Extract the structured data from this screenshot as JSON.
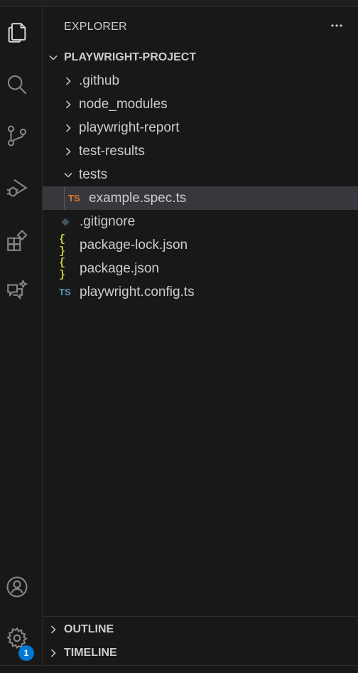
{
  "explorer": {
    "title": "EXPLORER",
    "project": "PLAYWRIGHT-PROJECT",
    "items": [
      {
        "label": ".github",
        "type": "folder"
      },
      {
        "label": "node_modules",
        "type": "folder"
      },
      {
        "label": "playwright-report",
        "type": "folder"
      },
      {
        "label": "test-results",
        "type": "folder"
      },
      {
        "label": "tests",
        "type": "folder-open"
      },
      {
        "label": "example.spec.ts",
        "type": "ts-file",
        "icon_text": "TS",
        "icon_color": "#e37933"
      },
      {
        "label": ".gitignore",
        "type": "git-file"
      },
      {
        "label": "package-lock.json",
        "type": "json-file",
        "icon_text": "{ }"
      },
      {
        "label": "package.json",
        "type": "json-file",
        "icon_text": "{ }"
      },
      {
        "label": "playwright.config.ts",
        "type": "ts-file",
        "icon_text": "TS",
        "icon_color": "#519aba"
      }
    ]
  },
  "panels": {
    "outline": "OUTLINE",
    "timeline": "TIMELINE"
  },
  "activity_bar": {
    "icons": [
      "explorer-icon",
      "search-icon",
      "source-control-icon",
      "run-debug-icon",
      "extensions-icon",
      "chat-icon",
      "account-icon",
      "settings-gear-icon"
    ],
    "settings_badge": "1"
  },
  "colors": {
    "background": "#181818",
    "selected_row": "#37373d",
    "badge": "#0078d4",
    "json_icon": "#cbcb41"
  }
}
